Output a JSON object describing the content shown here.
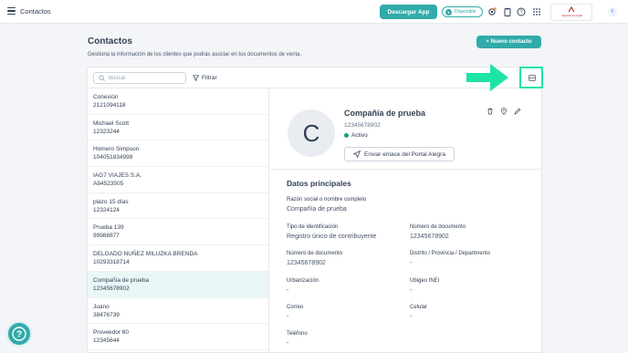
{
  "topbar": {
    "title": "Contactos",
    "download_label": "Descargar App",
    "available_label": "Disponible",
    "logo_text": "Depinto Complar",
    "avatar_initial": "F"
  },
  "page": {
    "title": "Contactos",
    "subtitle": "Gestiona la información de los clientes que podrás asociar en tus documentos de venta.",
    "new_contact_label": "+ Nuevo contacto"
  },
  "toolbar": {
    "search_placeholder": "Buscar",
    "filter_label": "Filtrar"
  },
  "contacts": [
    {
      "name": "Conexión",
      "id": "2121094118"
    },
    {
      "name": "Michael Scott",
      "id": "12323244"
    },
    {
      "name": "Homero Simpson",
      "id": "104051834999"
    },
    {
      "name": "IAG7 VIAJES S.A.",
      "id": "A84523505"
    },
    {
      "name": "plazo 15 días",
      "id": "12324124"
    },
    {
      "name": "Prueba 139",
      "id": "99988877"
    },
    {
      "name": "DELGADO NUÑEZ MILUZKA BRENDA",
      "id": "10293318714"
    },
    {
      "name": "Compañía de prueba",
      "id": "12345678902"
    },
    {
      "name": "Juano",
      "id": "38476739"
    },
    {
      "name": "Proveedor 60",
      "id": "12345644"
    }
  ],
  "selected_index": 7,
  "detail": {
    "avatar_letter": "C",
    "name": "Compañía de prueba",
    "id": "12345678902",
    "status": "Activo",
    "portal_label": "Enviar enlace del Portal Alegra",
    "section_title": "Datos principales",
    "fields": {
      "razon_label": "Razón social o nombre completo",
      "razon_value": "Compañía de prueba",
      "tipo_label": "Tipo de identificación",
      "tipo_value": "Registro único de contribuyente",
      "numdoc_label": "Número de documento",
      "numdoc_value": "12345678902",
      "numdoc2_label": "Número de documento",
      "numdoc2_value": "12345678902",
      "distrito_label": "Distrito / Provincia / Departmento",
      "distrito_value": "-",
      "urbanizacion_label": "Urbanización",
      "urbanizacion_value": "-",
      "ubigeo_label": "Ubigeo INEI",
      "ubigeo_value": "-",
      "correo_label": "Correo",
      "correo_value": "-",
      "celular_label": "Celular",
      "celular_value": "-",
      "telefono_label": "Teléfono",
      "telefono_value": "-"
    }
  },
  "colors": {
    "accent": "#30aba9",
    "highlight": "#1ee3a6",
    "status_active": "#22a06b"
  }
}
